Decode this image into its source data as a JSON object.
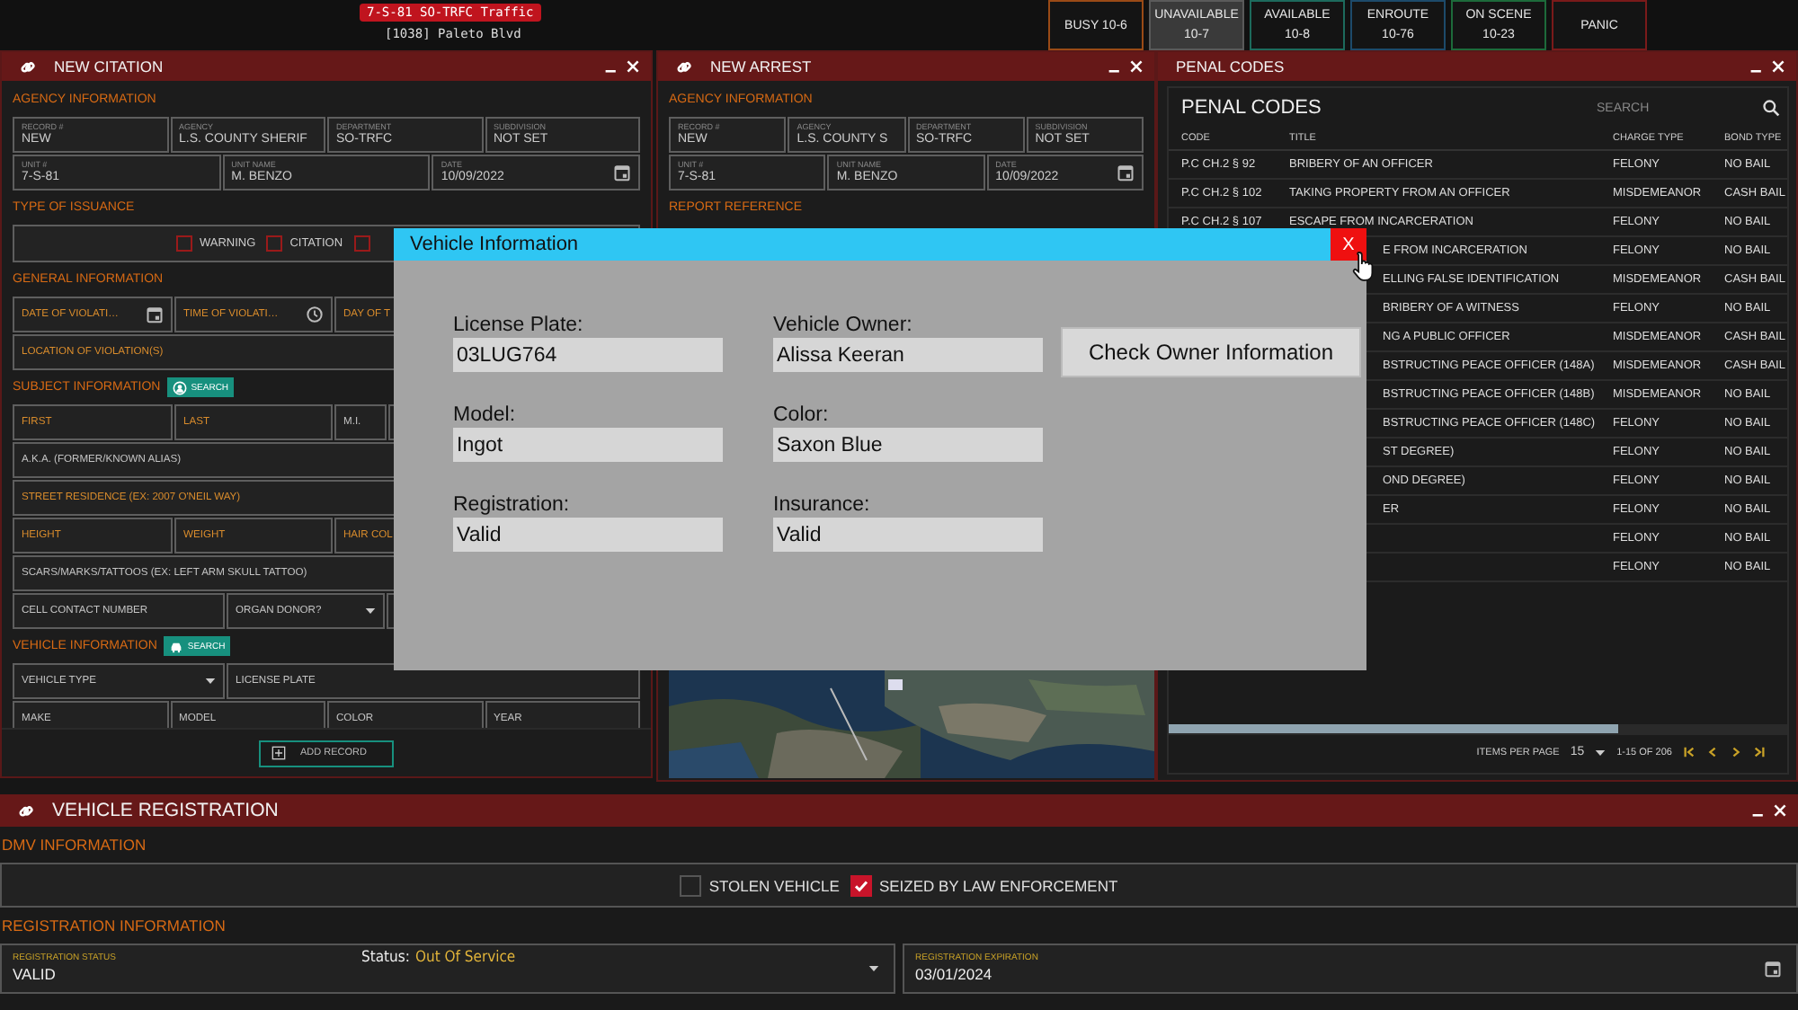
{
  "top_bar": {
    "unit_badge": "7-S-81 SO-TRFC Traffic",
    "location": "[1038] Paleto Blvd",
    "status_buttons": [
      {
        "label": "BUSY 10-6",
        "color": "#9a4a16",
        "selected": false
      },
      {
        "label": "UNAVAILABLE",
        "code": "10-7",
        "color": "#5a5a5a",
        "selected": true
      },
      {
        "label": "AVAILABLE",
        "code": "10-8",
        "color": "#1d6a5c",
        "selected": false
      },
      {
        "label": "ENROUTE",
        "code": "10-76",
        "color": "#1d4a6a",
        "selected": false
      },
      {
        "label": "ON SCENE",
        "code": "10-23",
        "color": "#1d6a3a",
        "selected": false
      },
      {
        "label": "PANIC",
        "color": "#7a1a1a",
        "selected": false
      }
    ]
  },
  "citation": {
    "title": "NEW CITATION",
    "sections": [
      {
        "heading": "AGENCY INFORMATION",
        "rows": [
          [
            {
              "kind": "text",
              "label": "RECORD #",
              "value": "NEW"
            },
            {
              "kind": "text",
              "label": "AGENCY",
              "value": "L.S. COUNTY SHERIF"
            },
            {
              "kind": "text",
              "label": "DEPARTMENT",
              "value": "SO-TRFC"
            },
            {
              "kind": "text",
              "label": "SUBDIVISION",
              "value": "NOT SET"
            }
          ],
          [
            {
              "kind": "text",
              "label": "UNIT #",
              "value": "7-S-81"
            },
            {
              "kind": "text",
              "label": "UNIT NAME",
              "value": "M. BENZO"
            },
            {
              "kind": "date",
              "label": "DATE",
              "value": "10/09/2022"
            }
          ]
        ]
      },
      {
        "heading": "TYPE OF ISSUANCE",
        "checks": [
          {
            "label": "WARNING",
            "checked": false
          },
          {
            "label": "CITATION",
            "checked": false
          },
          {
            "checked": false
          }
        ]
      },
      {
        "heading": "GENERAL INFORMATION",
        "rows": [
          [
            {
              "kind": "date",
              "placeholder": "DATE OF VIOLATI…",
              "required": true
            },
            {
              "kind": "time",
              "placeholder": "TIME OF VIOLATI…",
              "required": true
            },
            {
              "kind": "text",
              "placeholder": "DAY OF T",
              "required": true
            }
          ],
          [
            {
              "kind": "text",
              "placeholder": "LOCATION OF VIOLATION(S)",
              "required": true
            }
          ]
        ]
      },
      {
        "heading": "SUBJECT INFORMATION",
        "search": "SEARCH",
        "rows": [
          [
            {
              "kind": "text",
              "placeholder": "FIRST",
              "required": true
            },
            {
              "kind": "text",
              "placeholder": "LAST",
              "required": true
            },
            {
              "kind": "text",
              "placeholder": "M.I.",
              "required": false
            },
            {
              "kind": "text"
            }
          ],
          [
            {
              "kind": "text",
              "placeholder": "A.K.A. (FORMER/KNOWN ALIAS)",
              "required": false
            }
          ],
          [
            {
              "kind": "text",
              "placeholder": "STREET RESIDENCE (EX: 2007 O'NEIL WAY)",
              "required": true
            }
          ],
          [
            {
              "kind": "text",
              "placeholder": "HEIGHT",
              "required": true
            },
            {
              "kind": "text",
              "placeholder": "WEIGHT",
              "required": true
            },
            {
              "kind": "text",
              "placeholder": "HAIR COL",
              "required": true
            }
          ],
          [
            {
              "kind": "text",
              "placeholder": "SCARS/MARKS/TATTOOS (EX: LEFT ARM SKULL TATTOO)",
              "required": false
            }
          ],
          [
            {
              "kind": "text",
              "placeholder": "CELL CONTACT NUMBER",
              "required": false
            },
            {
              "kind": "select",
              "placeholder": "ORGAN DONOR?",
              "required": false
            },
            {
              "kind": "text"
            }
          ]
        ]
      },
      {
        "heading": "VEHICLE INFORMATION",
        "search": "SEARCH",
        "rows": [
          [
            {
              "kind": "select",
              "placeholder": "VEHICLE TYPE",
              "required": false
            },
            {
              "kind": "text",
              "placeholder": "LICENSE PLATE",
              "required": false
            }
          ],
          [
            {
              "kind": "text",
              "placeholder": "MAKE",
              "required": false
            },
            {
              "kind": "text",
              "placeholder": "MODEL",
              "required": false
            },
            {
              "kind": "text",
              "placeholder": "COLOR",
              "required": false
            },
            {
              "kind": "text",
              "placeholder": "YEAR",
              "required": false
            }
          ]
        ]
      }
    ],
    "add_button": "ADD RECORD"
  },
  "arrest": {
    "title": "NEW ARREST",
    "sections": [
      {
        "heading": "AGENCY INFORMATION",
        "rows": [
          [
            {
              "kind": "text",
              "label": "RECORD #",
              "value": "NEW"
            },
            {
              "kind": "text",
              "label": "AGENCY",
              "value": "L.S. COUNTY S"
            },
            {
              "kind": "text",
              "label": "DEPARTMENT",
              "value": "SO-TRFC"
            },
            {
              "kind": "text",
              "label": "SUBDIVISION",
              "value": "NOT SET"
            }
          ],
          [
            {
              "kind": "text",
              "label": "UNIT #",
              "value": "7-S-81"
            },
            {
              "kind": "text",
              "label": "UNIT NAME",
              "value": "M. BENZO"
            },
            {
              "kind": "date",
              "label": "DATE",
              "value": "10/09/2022"
            }
          ]
        ]
      },
      {
        "heading": "REPORT REFERENCE"
      }
    ]
  },
  "penal_codes": {
    "title": "PENAL CODES",
    "heading": "PENAL CODES",
    "search_placeholder": "SEARCH",
    "columns": [
      "CODE",
      "TITLE",
      "CHARGE TYPE",
      "BOND TYPE"
    ],
    "rows": [
      {
        "code": "P.C CH.2 § 92",
        "title": "BRIBERY OF AN OFFICER",
        "charge": "FELONY",
        "bond": "NO BAIL"
      },
      {
        "code": "P.C CH.2 § 102",
        "title": "TAKING PROPERTY FROM AN OFFICER",
        "charge": "MISDEMEANOR",
        "bond": "CASH BAIL"
      },
      {
        "code": "P.C CH.2 § 107",
        "title": "ESCAPE FROM INCARCERATION",
        "charge": "FELONY",
        "bond": "NO BAIL"
      },
      {
        "title": "E FROM INCARCERATION",
        "charge": "FELONY",
        "bond": "NO BAIL"
      },
      {
        "title": "ELLING FALSE IDENTIFICATION",
        "charge": "MISDEMEANOR",
        "bond": "CASH BAIL"
      },
      {
        "title": "BRIBERY OF A WITNESS",
        "charge": "FELONY",
        "bond": "NO BAIL"
      },
      {
        "title": "NG A PUBLIC OFFICER",
        "charge": "MISDEMEANOR",
        "bond": "CASH BAIL"
      },
      {
        "title": "BSTRUCTING PEACE OFFICER (148A)",
        "charge": "MISDEMEANOR",
        "bond": "CASH BAIL"
      },
      {
        "title": "BSTRUCTING PEACE OFFICER (148B)",
        "charge": "MISDEMEANOR",
        "bond": "NO BAIL"
      },
      {
        "title": "BSTRUCTING PEACE OFFICER (148C)",
        "charge": "FELONY",
        "bond": "NO BAIL"
      },
      {
        "title": "ST DEGREE)",
        "charge": "FELONY",
        "bond": "NO BAIL"
      },
      {
        "title": "OND DEGREE)",
        "charge": "FELONY",
        "bond": "NO BAIL"
      },
      {
        "title": "ER",
        "charge": "FELONY",
        "bond": "NO BAIL"
      },
      {
        "charge": "FELONY",
        "bond": "NO BAIL"
      },
      {
        "charge": "FELONY",
        "bond": "NO BAIL"
      }
    ],
    "items_per_page_label": "ITEMS PER PAGE",
    "items_per_page": "15",
    "range": "1-15 OF 206"
  },
  "vehicle_dialog": {
    "title": "Vehicle Information",
    "close_label": "X",
    "fields": [
      {
        "label": "License Plate:",
        "value": "03LUG764"
      },
      {
        "label": "Vehicle Owner:",
        "value": "Alissa Keeran"
      },
      {
        "label": "Model:",
        "value": "Ingot"
      },
      {
        "label": "Color:",
        "value": "Saxon Blue"
      },
      {
        "label": "Registration:",
        "value": "Valid"
      },
      {
        "label": "Insurance:",
        "value": "Valid"
      }
    ],
    "button": "Check Owner Information"
  },
  "vehicle_registration": {
    "title": "VEHICLE REGISTRATION",
    "dmv_heading": "DMV INFORMATION",
    "checks": [
      {
        "label": "STOLEN VEHICLE",
        "checked": false
      },
      {
        "label": "SEIZED BY LAW ENFORCEMENT",
        "checked": true
      }
    ],
    "registration_heading": "REGISTRATION INFORMATION",
    "status_field": {
      "label": "REGISTRATION STATUS",
      "value": "VALID"
    },
    "status_note": {
      "label": "Status:",
      "value": "Out Of Service"
    },
    "expiration_field": {
      "label": "REGISTRATION EXPIRATION",
      "value": "03/01/2024"
    }
  }
}
